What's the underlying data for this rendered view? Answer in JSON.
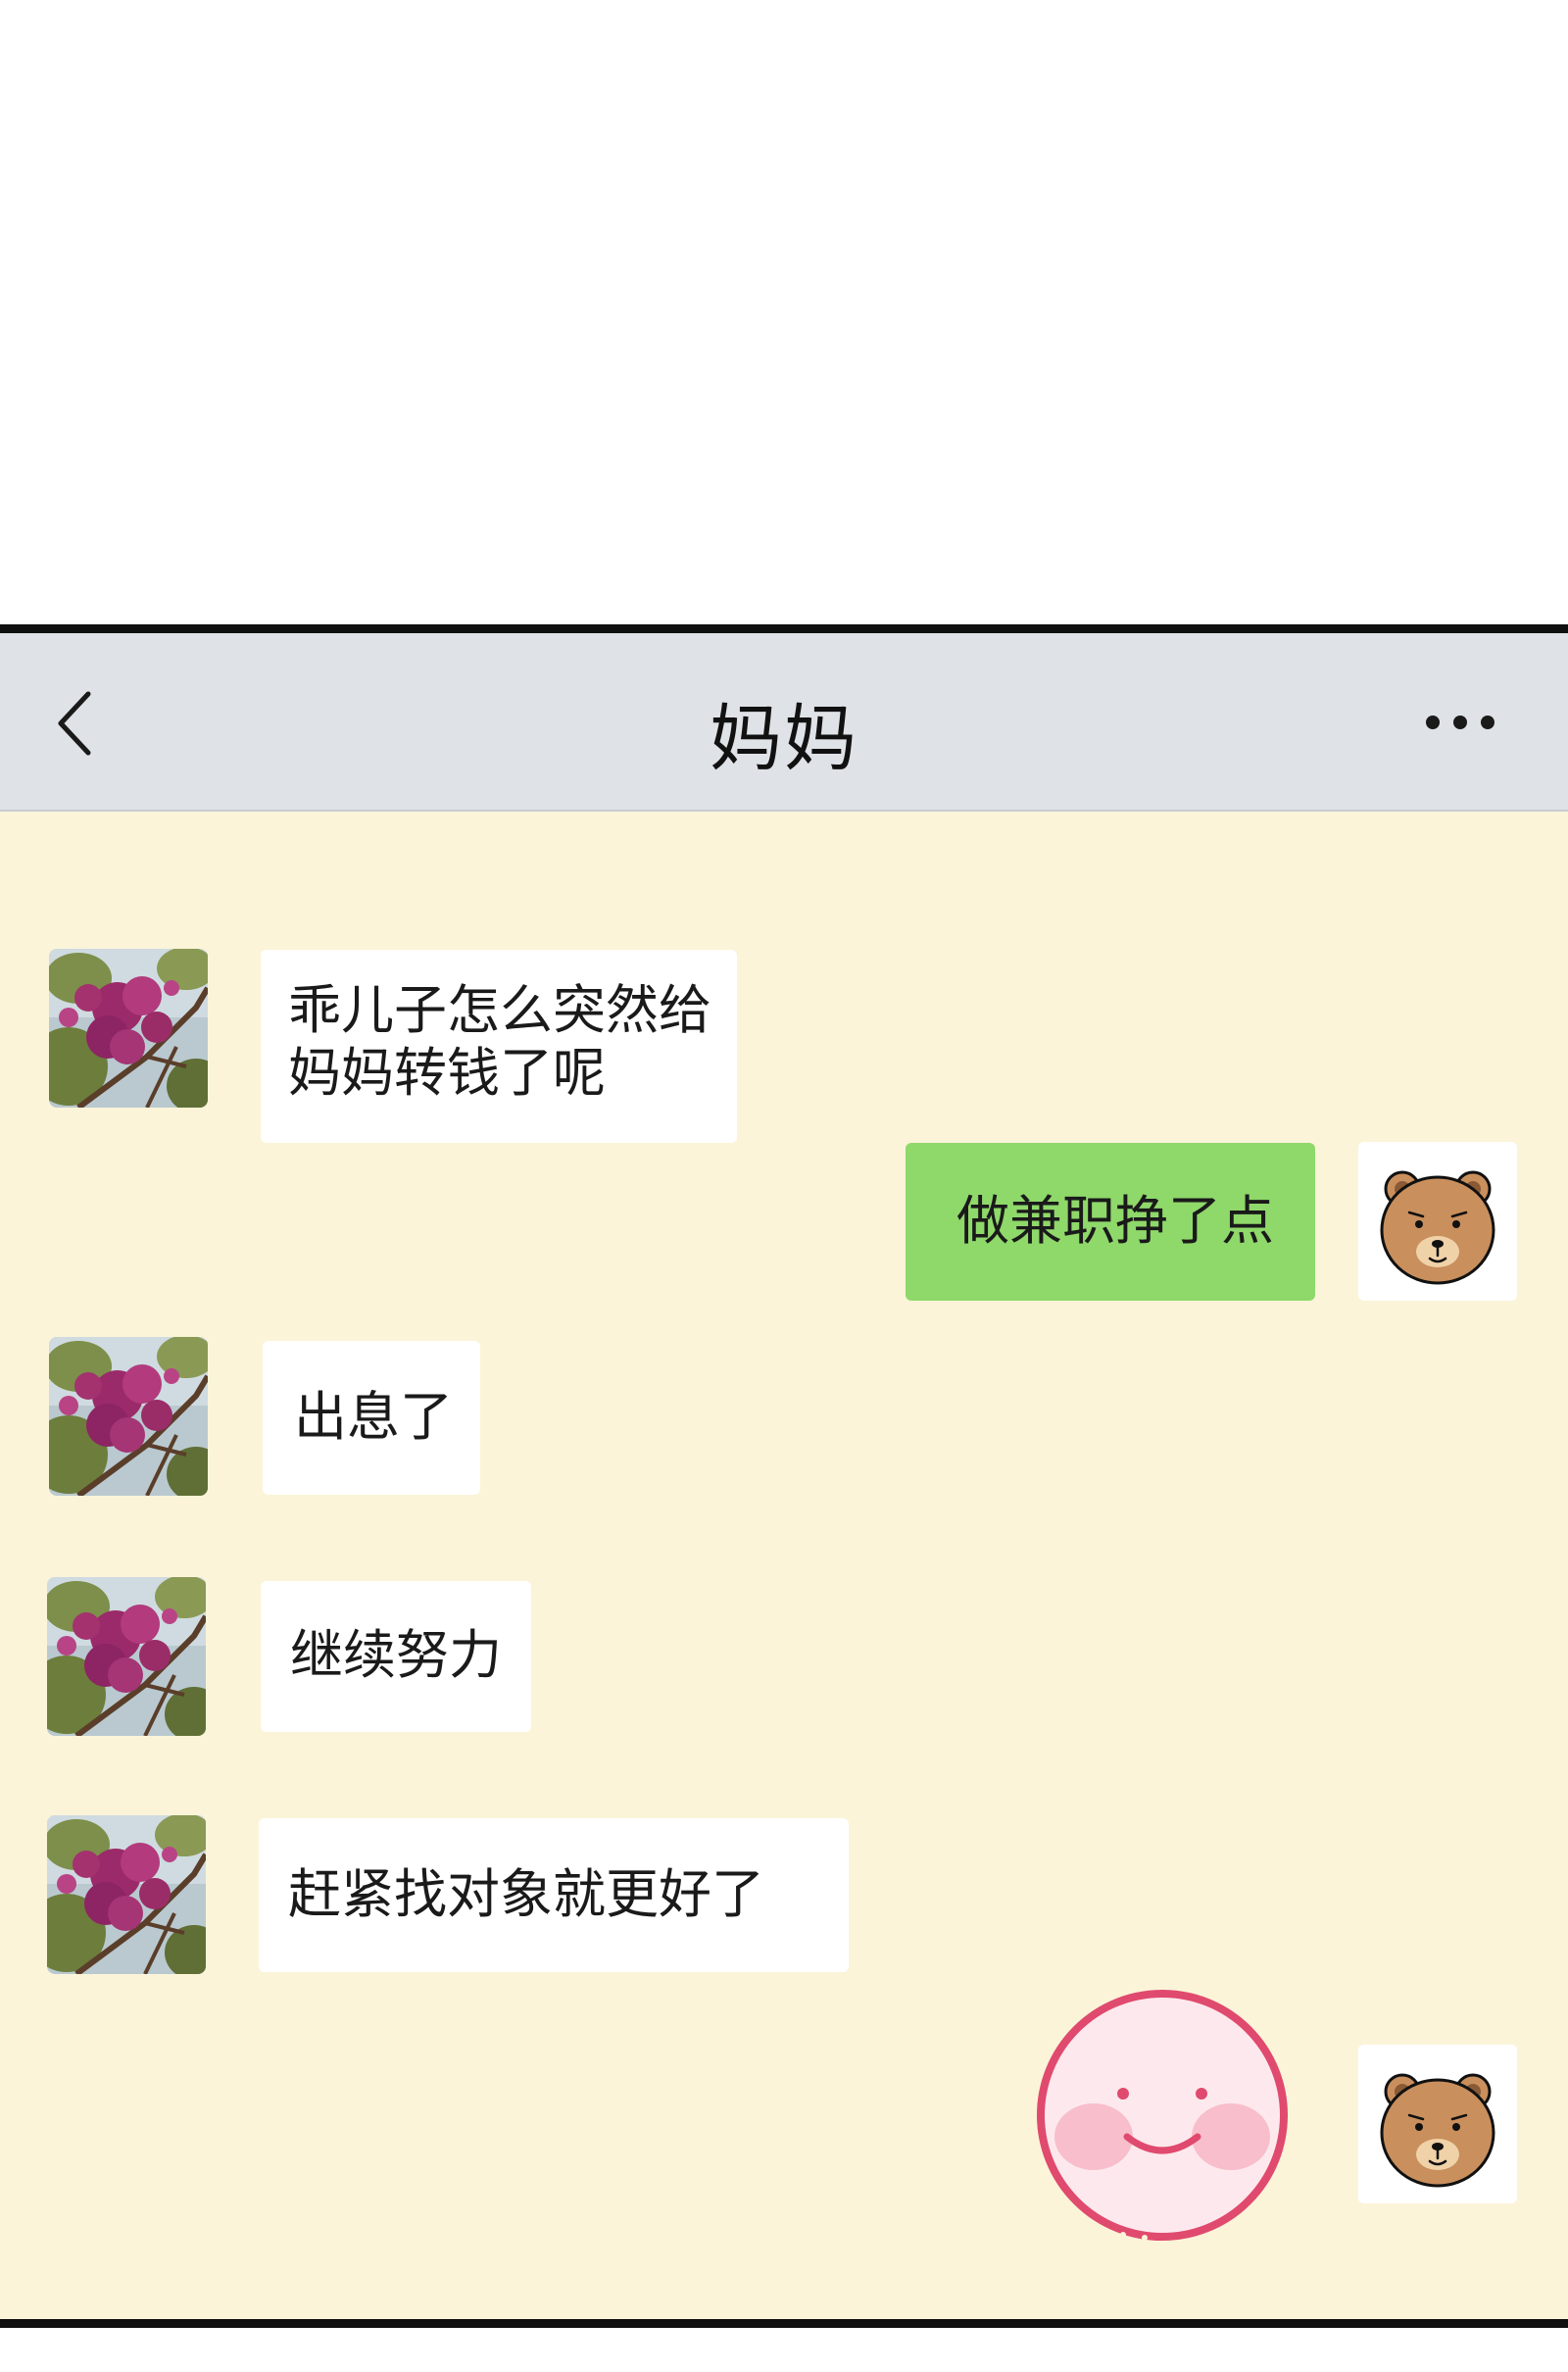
{
  "header": {
    "title": "妈妈",
    "back_icon": "chevron-left-icon",
    "more_icon": "more-dots-icon"
  },
  "contact": {
    "avatar_icon": "flower-photo-avatar"
  },
  "self": {
    "avatar_icon": "bear-avatar"
  },
  "messages": [
    {
      "from": "contact",
      "lines": [
        "乖儿子怎么突然给",
        "妈妈转钱了呢"
      ]
    },
    {
      "from": "self",
      "lines": [
        "做兼职挣了点"
      ]
    },
    {
      "from": "contact",
      "lines": [
        "出息了"
      ]
    },
    {
      "from": "contact",
      "lines": [
        "继续努力"
      ]
    },
    {
      "from": "contact",
      "lines": [
        "赶紧找对象就更好了"
      ]
    },
    {
      "from": "self",
      "sticker": "smiley-face-sticker"
    }
  ],
  "colors": {
    "chat_background": "#fbf4d8",
    "nav_background": "#dfe2e6",
    "sent_bubble": "#8fd86a",
    "received_bubble": "#ffffff",
    "frame_border": "#101010"
  }
}
